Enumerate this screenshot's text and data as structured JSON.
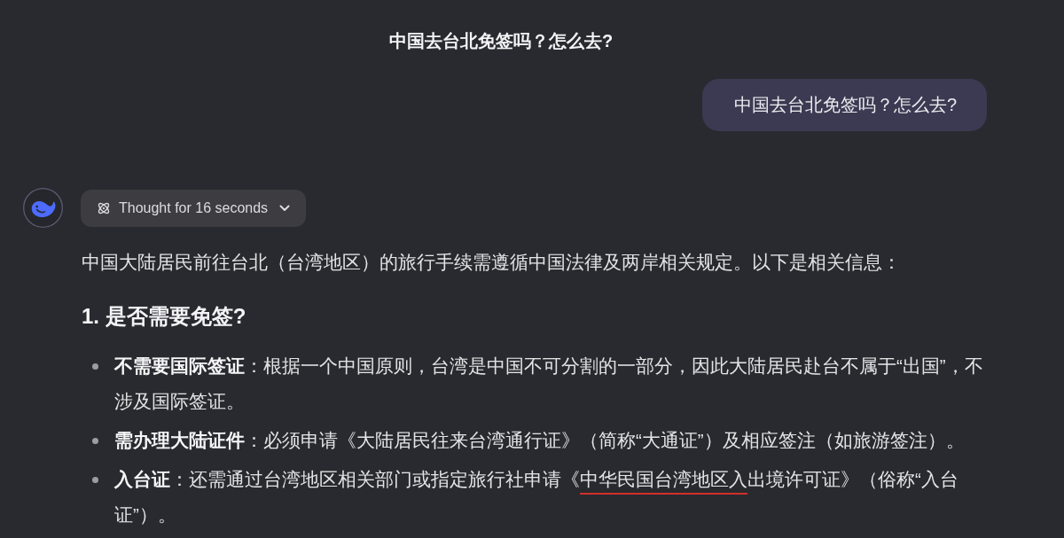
{
  "header": {
    "title": "中国去台北免签吗？怎么去?"
  },
  "user_message": {
    "text": "中国去台北免签吗？怎么去?"
  },
  "assistant": {
    "thought_toggle": {
      "label": "Thought for 16 seconds",
      "expanded": false
    },
    "answer": {
      "intro": "中国大陆居民前往台北（台湾地区）的旅行手续需遵循中国法律及两岸相关规定。以下是相关信息：",
      "heading": "1. 是否需要免签?",
      "bullets": [
        {
          "label": "不需要国际签证",
          "segments": [
            {
              "text": "：根据一个中国原则，台湾是中国不可分割的一部分，因此大陆居民赴台不属于“出国”，不涉及国际签证。",
              "underlined": false
            }
          ]
        },
        {
          "label": "需办理大陆证件",
          "segments": [
            {
              "text": "：必须申请《大陆居民往来台湾通行证》（简称“大通证”）及相应签注（如旅游签注）。",
              "underlined": false
            }
          ]
        },
        {
          "label": "入台证",
          "segments": [
            {
              "text": "：还需通过台湾地区相关部门或指定旅行社申请《",
              "underlined": false
            },
            {
              "text": "中华民国台湾地区入",
              "underlined": true
            },
            {
              "text": "出境许可证》（俗称“入台证”）。",
              "underlined": false
            }
          ]
        }
      ]
    }
  }
}
